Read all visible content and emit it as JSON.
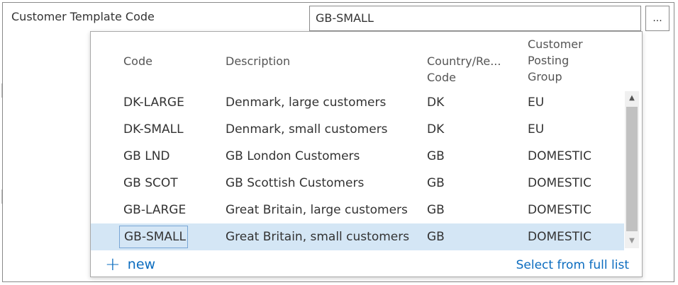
{
  "field": {
    "label": "Customer Template Code",
    "value": "GB-SMALL",
    "assist_label": "..."
  },
  "lookup": {
    "headers": {
      "code": "Code",
      "description": "Description",
      "country_line1": "Country/Re...",
      "country_line2": "Code",
      "posting_line1": "Customer",
      "posting_line2": "Posting",
      "posting_line3": "Group"
    },
    "rows": [
      {
        "code": "DK-LARGE",
        "description": "Denmark, large customers",
        "country": "DK",
        "posting_group": "EU"
      },
      {
        "code": "DK-SMALL",
        "description": "Denmark, small customers",
        "country": "DK",
        "posting_group": "EU"
      },
      {
        "code": "GB LND",
        "description": "GB London Customers",
        "country": "GB",
        "posting_group": "DOMESTIC"
      },
      {
        "code": "GB SCOT",
        "description": "GB Scottish Customers",
        "country": "GB",
        "posting_group": "DOMESTIC"
      },
      {
        "code": "GB-LARGE",
        "description": "Great Britain, large customers",
        "country": "GB",
        "posting_group": "DOMESTIC"
      },
      {
        "code": "GB-SMALL",
        "description": "Great Britain, small customers",
        "country": "GB",
        "posting_group": "DOMESTIC"
      }
    ],
    "selected_code": "GB-SMALL",
    "footer": {
      "new_label": "new",
      "full_list_label": "Select from full list"
    }
  },
  "icons": {
    "plus": "plus-icon",
    "scroll_up": "scroll-up-icon",
    "scroll_down": "scroll-down-icon"
  },
  "colors": {
    "link": "#0b6cbf",
    "selected_row": "#d4e6f5",
    "focus_border": "#7aa7d6"
  }
}
